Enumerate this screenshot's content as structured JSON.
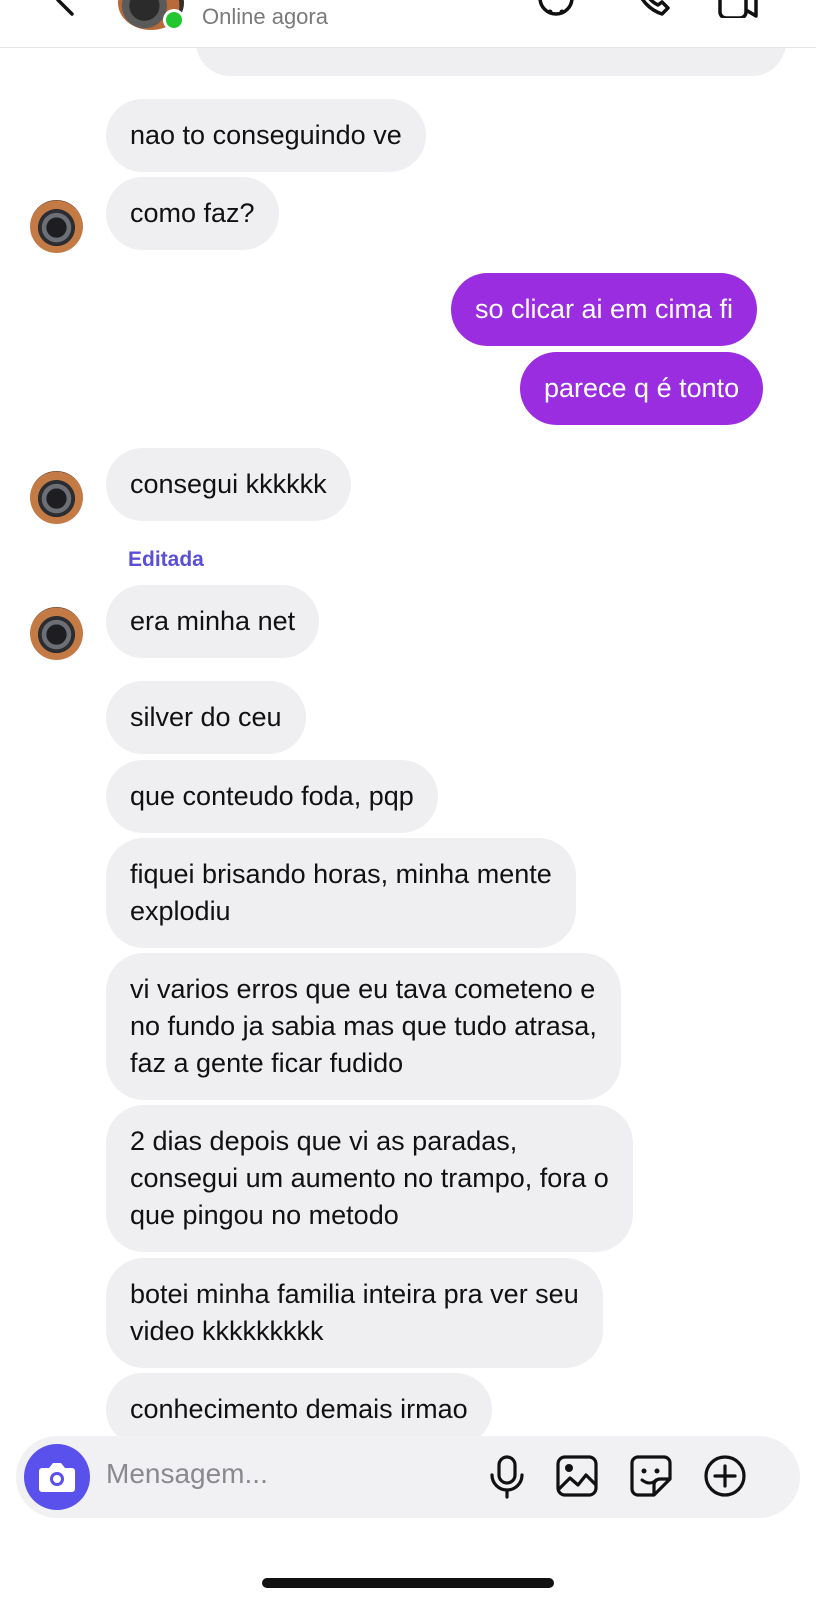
{
  "header": {
    "status": "Online agora",
    "online_color": "#22c62f",
    "icons": [
      "back-chevron-icon",
      "sticker-face-icon",
      "phone-icon",
      "video-call-icon"
    ]
  },
  "messages": [
    {
      "dir": "in",
      "text": "nao to conseguindo ve"
    },
    {
      "dir": "in",
      "text": "como faz?"
    },
    {
      "dir": "out",
      "text": "so clicar ai em cima fi"
    },
    {
      "dir": "out",
      "text": "parece q é tonto"
    },
    {
      "dir": "in",
      "text": "consegui kkkkkk"
    },
    {
      "dir": "in",
      "text": "era minha net",
      "label": "Editada"
    },
    {
      "dir": "in",
      "text": "silver do ceu"
    },
    {
      "dir": "in",
      "text": "que conteudo foda, pqp"
    },
    {
      "dir": "in",
      "text": "fiquei brisando horas, minha mente\nexplodiu"
    },
    {
      "dir": "in",
      "text": "vi varios erros que eu tava cometeno e\nno fundo ja sabia mas que tudo atrasa,\nfaz a gente ficar fudido"
    },
    {
      "dir": "in",
      "text": "2 dias depois que vi as paradas,\nconsegui um aumento no trampo, fora o\nque pingou no metodo"
    },
    {
      "dir": "in",
      "text": "botei minha familia inteira pra ver seu\nvideo kkkkkkkkk"
    },
    {
      "dir": "in",
      "text": "conhecimento demais irmao"
    }
  ],
  "composer": {
    "placeholder": "Mensagem...",
    "icons": [
      "camera-icon",
      "microphone-icon",
      "gallery-icon",
      "sticker-icon",
      "add-icon"
    ]
  },
  "colors": {
    "outgoing_bubble": "#9b2de0",
    "incoming_bubble": "#efeff2",
    "accent": "#5a50ec",
    "edited_label": "#5a4fd6"
  }
}
